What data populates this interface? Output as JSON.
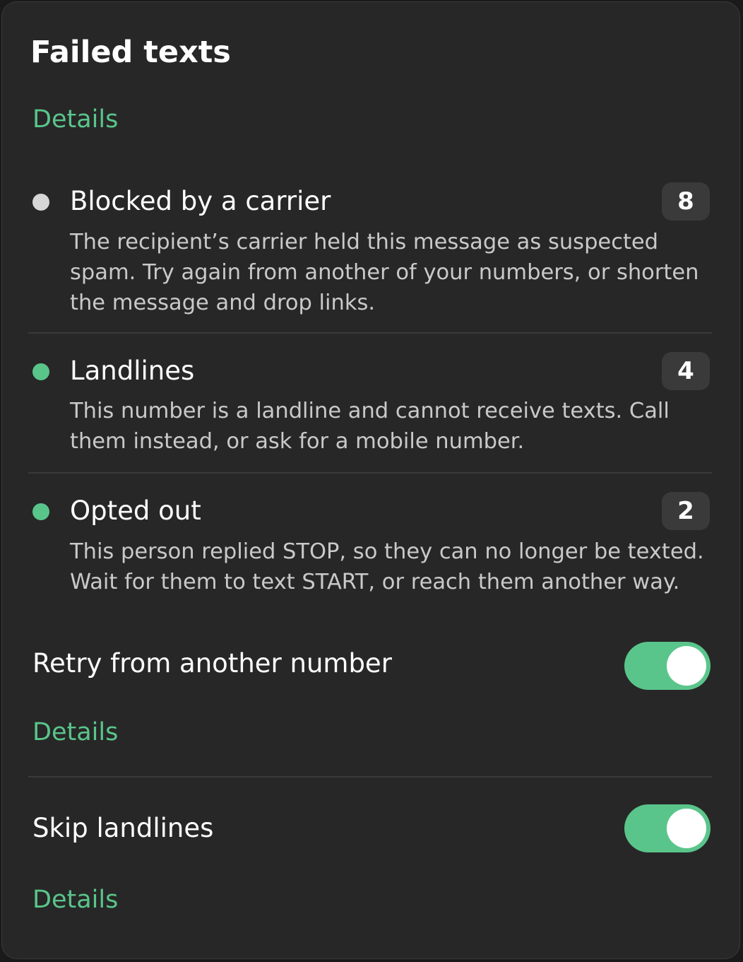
{
  "header": {
    "title": "Failed texts",
    "details_label": "Details"
  },
  "reasons": [
    {
      "title": "Blocked by a carrier",
      "count": "8",
      "dot_color": "#d6d6d6",
      "description_lines": [
        "The recipient’s carrier held this message as suspected",
        "spam. Try again from another of your numbers, or shorten",
        "the message and drop links."
      ]
    },
    {
      "title": "Landlines",
      "count": "4",
      "dot_color": "#5ac58b",
      "description_lines": [
        "This number is a landline and cannot receive texts. Call",
        "them instead, or ask for a mobile number."
      ]
    },
    {
      "title": "Opted out",
      "count": "2",
      "dot_color": "#5ac58b",
      "description_lines": [
        "This person replied STOP, so they can no longer be texted.",
        "Wait for them to text START, or reach them another way."
      ]
    }
  ],
  "settings": [
    {
      "label": "Retry from another number",
      "enabled": true,
      "details_label": "Details"
    },
    {
      "label": "Skip landlines",
      "enabled": true,
      "details_label": "Details"
    }
  ],
  "colors": {
    "accent": "#5ac58b",
    "panel_bg": "#272727",
    "badge_bg": "#3a3a3a",
    "muted_dot": "#d6d6d6"
  },
  "icons": {
    "status_dot": "status-dot-icon"
  }
}
